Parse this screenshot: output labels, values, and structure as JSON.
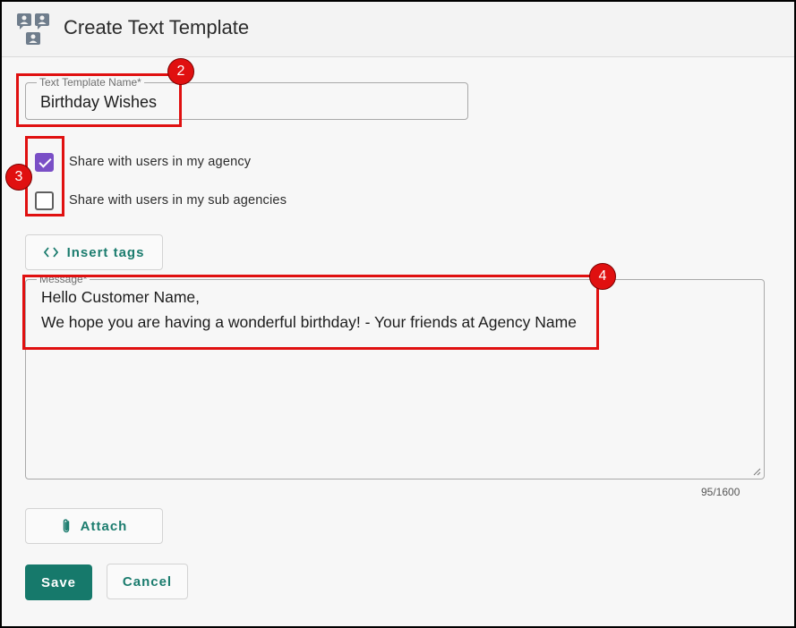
{
  "header": {
    "title": "Create Text Template",
    "icon": "contacts-tree-icon"
  },
  "template_name": {
    "label": "Text Template Name*",
    "value": "Birthday Wishes"
  },
  "share_options": [
    {
      "label": "Share with users in my agency",
      "checked": true
    },
    {
      "label": "Share with users in my sub agencies",
      "checked": false
    }
  ],
  "insert_tags": {
    "label": "Insert tags",
    "icon": "code-brackets-icon"
  },
  "message": {
    "label": "Message*",
    "lines": [
      "Hello Customer Name,",
      "We hope you are having a wonderful birthday! - Your friends at Agency Name"
    ],
    "counter": "95/1600"
  },
  "attach": {
    "label": "Attach",
    "icon": "paperclip-icon"
  },
  "actions": {
    "save": "Save",
    "cancel": "Cancel"
  },
  "callouts": [
    "2",
    "3",
    "4"
  ],
  "colors": {
    "accent": "#16796b",
    "checkbox": "#7a4fc6",
    "callout": "#e01010"
  }
}
